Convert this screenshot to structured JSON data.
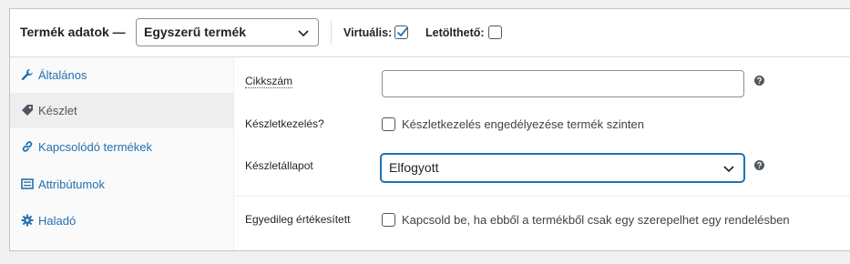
{
  "header": {
    "title": "Termék adatok —",
    "product_type": "Egyszerű termék",
    "virtual_label": "Virtuális:",
    "virtual_checked": true,
    "downloadable_label": "Letölthető:",
    "downloadable_checked": false
  },
  "sidebar": {
    "items": [
      {
        "label": "Általános",
        "icon": "wrench-icon",
        "active": false
      },
      {
        "label": "Készlet",
        "icon": "tag-icon",
        "active": true
      },
      {
        "label": "Kapcsolódó termékek",
        "icon": "link-icon",
        "active": false
      },
      {
        "label": "Attribútumok",
        "icon": "list-icon",
        "active": false
      },
      {
        "label": "Haladó",
        "icon": "gear-icon",
        "active": false
      }
    ]
  },
  "inventory": {
    "sku_label": "Cikkszám",
    "sku_value": "",
    "manage_stock_label": "Készletkezelés?",
    "manage_stock_desc": "Készletkezelés engedélyezése termék szinten",
    "manage_stock_checked": false,
    "stock_status_label": "Készletállapot",
    "stock_status_value": "Elfogyott",
    "sold_individually_label": "Egyedileg értékesített",
    "sold_individually_desc": "Kapcsold be, ha ebből a termékből csak egy szerepelhet egy rendelésben",
    "sold_individually_checked": false
  },
  "colors": {
    "link": "#2271b1",
    "active_tab_bg": "#eeeeee",
    "text": "#1d2327"
  }
}
